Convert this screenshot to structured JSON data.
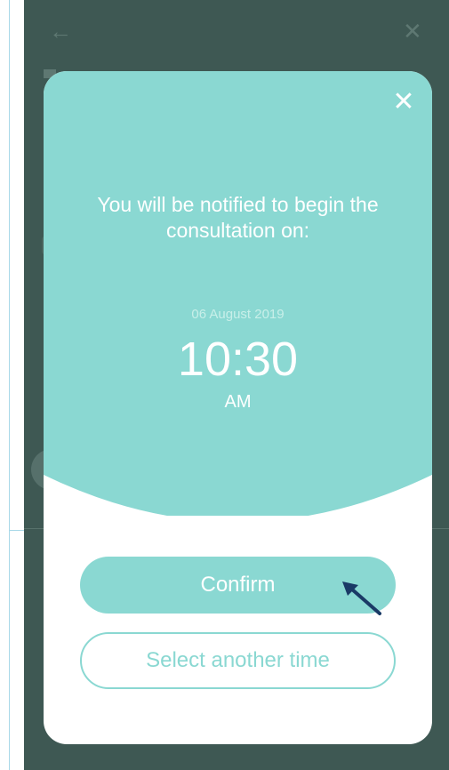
{
  "background": {
    "back_icon": "←",
    "close_icon": "✕"
  },
  "modal": {
    "close_icon": "✕",
    "message": "You will be notified to begin the consultation on:",
    "date": "06 August 2019",
    "time": "10:30",
    "meridiem": "AM",
    "confirm_label": "Confirm",
    "alternate_label": "Select another time"
  },
  "colors": {
    "accent": "#8ad8d2",
    "overlay": "#3e5853",
    "arrow": "#1a3a66"
  }
}
